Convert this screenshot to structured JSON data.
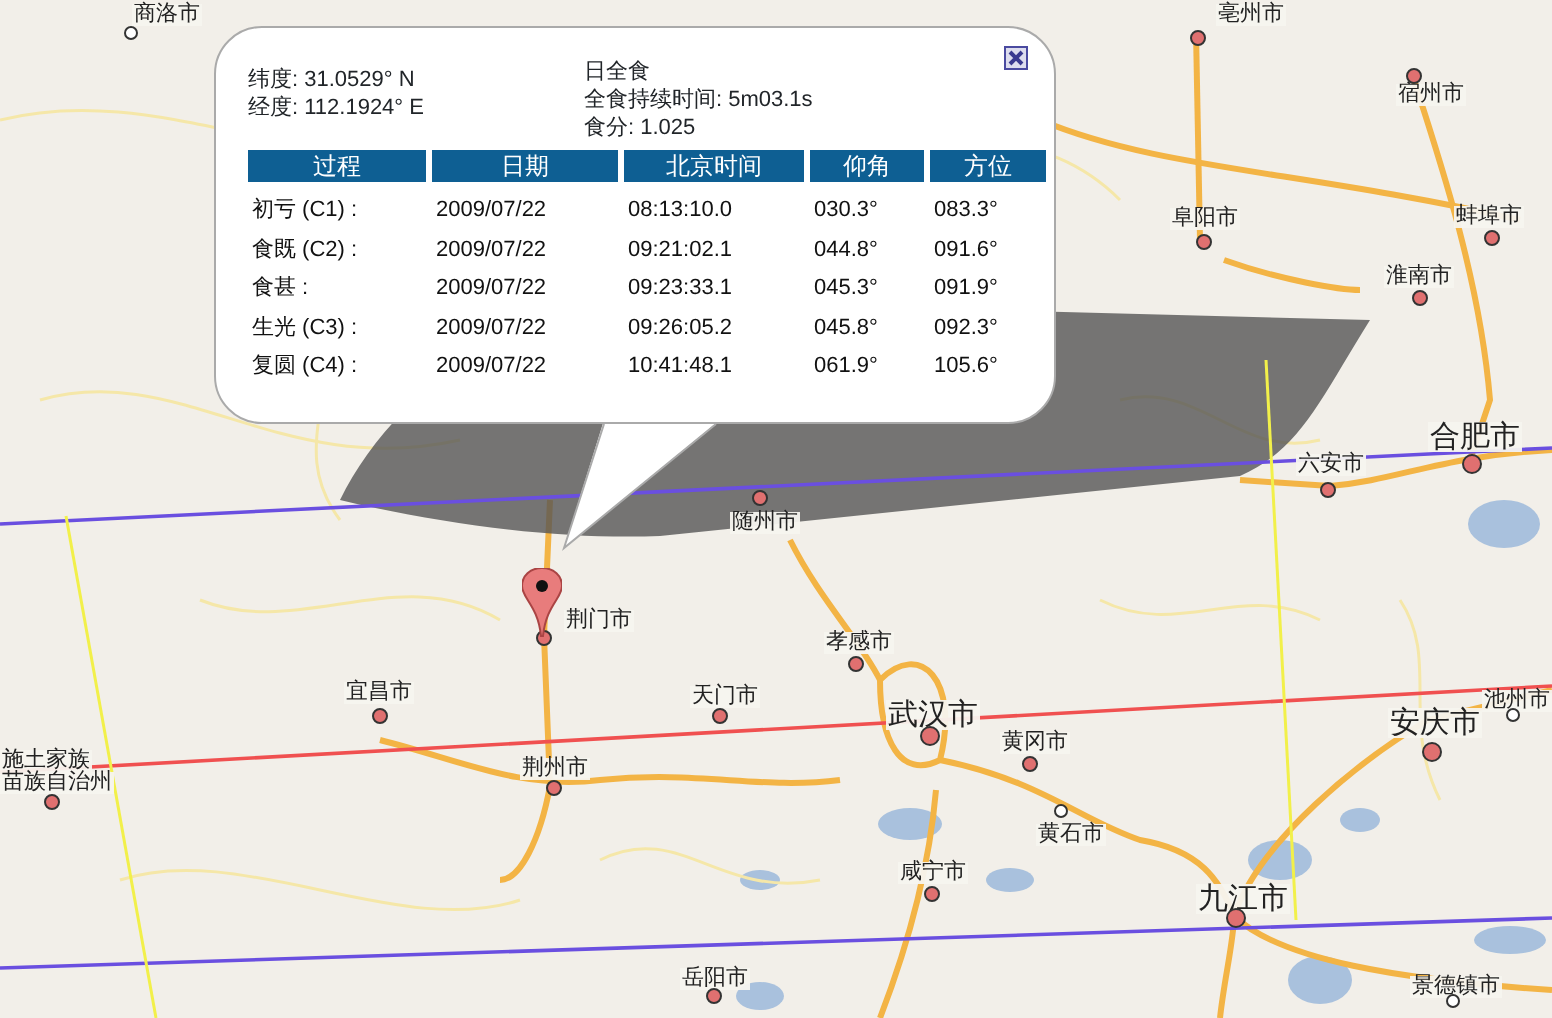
{
  "map": {
    "cities": [
      {
        "name": "商洛市",
        "kind": "town"
      },
      {
        "name": "亳州市",
        "kind": "city"
      },
      {
        "name": "宿州市",
        "kind": "city"
      },
      {
        "name": "阜阳市",
        "kind": "city"
      },
      {
        "name": "蚌埠市",
        "kind": "city"
      },
      {
        "name": "淮南市",
        "kind": "city"
      },
      {
        "name": "合肥市",
        "kind": "capital"
      },
      {
        "name": "六安市",
        "kind": "city"
      },
      {
        "name": "随州市",
        "kind": "city"
      },
      {
        "name": "荆门市",
        "kind": "city"
      },
      {
        "name": "宜昌市",
        "kind": "city"
      },
      {
        "name": "天门市",
        "kind": "city"
      },
      {
        "name": "荆州市",
        "kind": "city"
      },
      {
        "name": "孝感市",
        "kind": "city"
      },
      {
        "name": "武汉市",
        "kind": "capital"
      },
      {
        "name": "黄冈市",
        "kind": "city"
      },
      {
        "name": "黄石市",
        "kind": "town"
      },
      {
        "name": "咸宁市",
        "kind": "city"
      },
      {
        "name": "九江市",
        "kind": "capital"
      },
      {
        "name": "安庆市",
        "kind": "capital"
      },
      {
        "name": "池州市",
        "kind": "town"
      },
      {
        "name": "岳阳市",
        "kind": "city"
      },
      {
        "name": "景德镇市",
        "kind": "town"
      },
      {
        "name": "施土家族",
        "kind": "label"
      },
      {
        "name": "苗族自治州",
        "kind": "city"
      }
    ]
  },
  "popup": {
    "latitude": "纬度: 31.0529° N",
    "longitude": "经度: 112.1924° E",
    "eclipse_type": "日全食",
    "duration": "全食持续时间: 5m03.1s",
    "magnitude": "食分: 1.025",
    "table": {
      "columns": [
        "过程",
        "日期",
        "北京时间",
        "仰角",
        "方位"
      ],
      "rows": [
        [
          "初亏 (C1) :",
          "2009/07/22",
          "08:13:10.0",
          "030.3°",
          "083.3°"
        ],
        [
          "食既 (C2) :",
          "2009/07/22",
          "09:21:02.1",
          "044.8°",
          "091.6°"
        ],
        [
          "食甚 :",
          "2009/07/22",
          "09:23:33.1",
          "045.3°",
          "091.9°"
        ],
        [
          "生光 (C3) :",
          "2009/07/22",
          "09:26:05.2",
          "045.8°",
          "092.3°"
        ],
        [
          "复圆 (C4) :",
          "2009/07/22",
          "10:41:48.1",
          "061.9°",
          "105.6°"
        ]
      ]
    }
  }
}
